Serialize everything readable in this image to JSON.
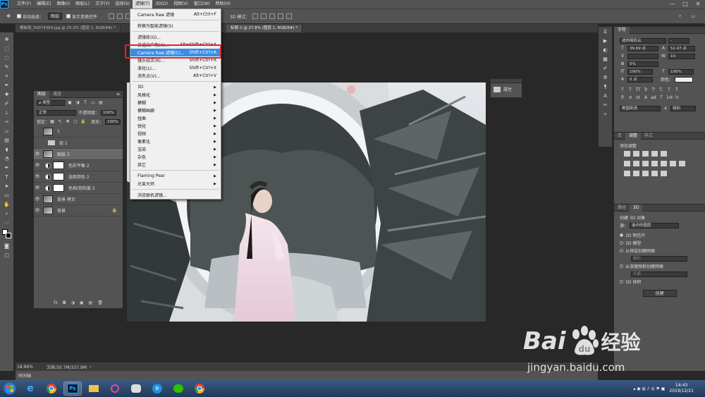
{
  "menubar": {
    "logo": "Ps",
    "items": [
      "文件(F)",
      "编辑(E)",
      "图像(I)",
      "图层(L)",
      "文字(Y)",
      "选择(S)",
      "滤镜(T)",
      "3D(D)",
      "视图(V)",
      "窗口(W)",
      "帮助(H)"
    ],
    "active_index": 6
  },
  "window_controls": {
    "minimize": "—",
    "restore": "□",
    "close": "✕"
  },
  "options": {
    "auto_select": "自动选择：",
    "auto_select_target": "图层",
    "show_transform": "显示变换控件",
    "mode_3d": "3D 模式："
  },
  "tabs": [
    "模板局_50074364.jpg @ 25.3% (图层 1, RGB/8#) *",
    "标题-1 @ 27.8% (图层 1, RGB/8#) *"
  ],
  "filter_menu": {
    "items": [
      {
        "label": "Camera Raw 滤镜",
        "shortcut": "Alt+Ctrl+F"
      },
      {
        "sep": true
      },
      {
        "label": "转换为智能滤镜(S)",
        "shortcut": ""
      },
      {
        "sep": true
      },
      {
        "label": "滤镜库(G)...",
        "shortcut": ""
      },
      {
        "label": "自适应广角(A)...",
        "shortcut": "Alt+Shift+Ctrl+A"
      },
      {
        "label": "Camera Raw 滤镜(C)...",
        "shortcut": "Shift+Ctrl+A",
        "highlighted": true
      },
      {
        "label": "镜头校正(R)...",
        "shortcut": "Shift+Ctrl+R"
      },
      {
        "label": "液化(L)...",
        "shortcut": "Shift+Ctrl+X"
      },
      {
        "label": "消失点(V)...",
        "shortcut": "Alt+Ctrl+V"
      },
      {
        "sep": true
      },
      {
        "label": "3D",
        "submenu": true
      },
      {
        "label": "风格化",
        "submenu": true
      },
      {
        "label": "模糊",
        "submenu": true
      },
      {
        "label": "模糊画廊",
        "submenu": true
      },
      {
        "label": "扭曲",
        "submenu": true
      },
      {
        "label": "锐化",
        "submenu": true
      },
      {
        "label": "视频",
        "submenu": true
      },
      {
        "label": "像素化",
        "submenu": true
      },
      {
        "label": "渲染",
        "submenu": true
      },
      {
        "label": "杂色",
        "submenu": true
      },
      {
        "label": "其它",
        "submenu": true
      },
      {
        "sep": true
      },
      {
        "label": "Flaming Pear",
        "submenu": true
      },
      {
        "label": "光束大师",
        "submenu": true
      },
      {
        "sep": true
      },
      {
        "label": "浏览联机滤镜...",
        "shortcut": ""
      }
    ],
    "submenu_arrow": "▶"
  },
  "layers_panel": {
    "tabs": [
      "图层",
      "通道"
    ],
    "filter_label": "ρ 类型",
    "blend_mode": "正常",
    "opacity_label": "不透明度：",
    "opacity": "100%",
    "lock_label": "锁定：",
    "fill_label": "填充：",
    "fill": "100%",
    "layers": [
      {
        "name": "1",
        "visible": false,
        "selected": false
      },
      {
        "name": "组 1",
        "visible": false,
        "selected": false,
        "group": true
      },
      {
        "name": "图层 3",
        "visible": true,
        "selected": true
      },
      {
        "name": "色彩平衡 2",
        "visible": true,
        "selected": false,
        "adjust": true
      },
      {
        "name": "选取颜色 2",
        "visible": true,
        "selected": false,
        "adjust": true
      },
      {
        "name": "色相/饱和度 2",
        "visible": true,
        "selected": false,
        "adjust": true
      },
      {
        "name": "背景 拷贝",
        "visible": true,
        "selected": false
      },
      {
        "name": "背景",
        "visible": true,
        "selected": false,
        "locked": true
      }
    ],
    "footer": [
      "fx",
      "◘",
      "◑",
      "▣",
      "▤",
      "🗑"
    ]
  },
  "properties_mini": {
    "label": "属性"
  },
  "character_panel": {
    "tab": "字符",
    "font_family": "迷你简彩云",
    "font_style": "-",
    "font_size": "36.69 点",
    "leading": "52.47 点",
    "kerning": "",
    "tracking": "10",
    "scale_pct": "0%",
    "v_scale": "100%",
    "h_scale": "100%",
    "baseline": "0 点",
    "color_label": "颜色：",
    "style_buttons": [
      "T",
      "T",
      "TT",
      "Tr",
      "T'",
      "T,",
      "T",
      "T"
    ],
    "lang": "美国英语",
    "aa": "锐利"
  },
  "adjust_panel": {
    "tabs": [
      "库",
      "调整",
      "样式"
    ],
    "add_label": "添加调整"
  },
  "panel3d": {
    "tabs": [
      "路径",
      "3D"
    ],
    "new_label": "创建 3D 对象",
    "source_label": "源：",
    "source_value": "选中的图层",
    "options": [
      "3D 明信片",
      "3D 模型",
      "从预设创建网格",
      "从深度映射创建网格",
      "3D 体积"
    ],
    "sub1": "锥形",
    "sub2": "平面",
    "create_btn": "创建"
  },
  "statusbar": {
    "zoom": "18.96%",
    "doc": "文档:50.7M/337.9M"
  },
  "timeline": {
    "label": "时间轴"
  },
  "taskbar": {
    "time": "14:43",
    "date": "2019/12/21"
  },
  "watermark": {
    "brand": "Bai",
    "brand2": "经验",
    "site": "jingyan.baidu.com"
  },
  "colors": {
    "accent": "#3a8ee6",
    "highlight_box": "#e8202a",
    "panel": "#535353",
    "menu_bg": "#f0f0f0"
  }
}
